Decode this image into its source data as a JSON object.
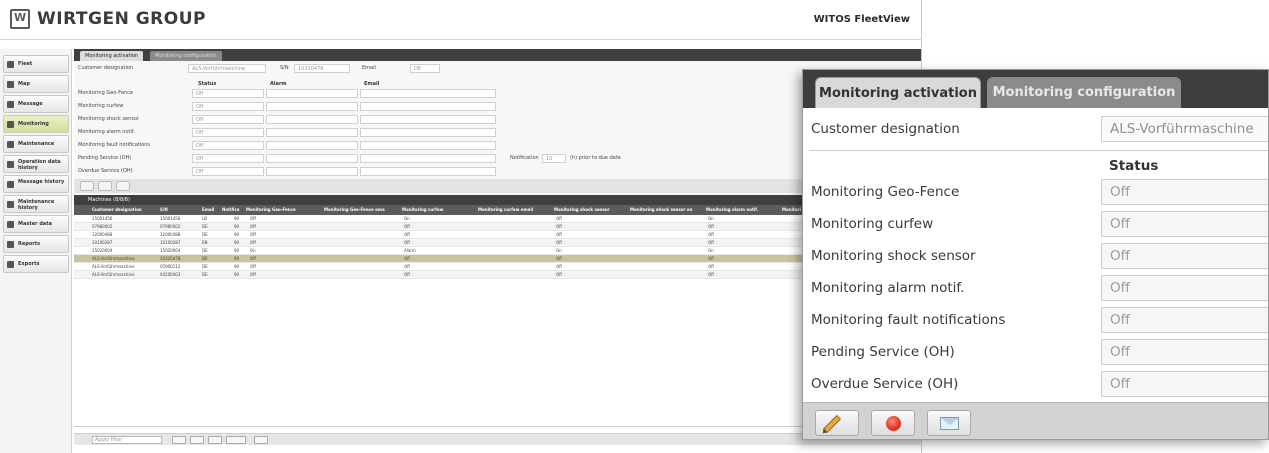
{
  "app": {
    "brand": "WIRTGEN GROUP",
    "product": "WITOS FleetView"
  },
  "sidebar": {
    "items": [
      {
        "label": "Fleet"
      },
      {
        "label": "Map"
      },
      {
        "label": "Message"
      },
      {
        "label": "Monitoring"
      },
      {
        "label": "Maintenance"
      },
      {
        "label": "Operation data history"
      },
      {
        "label": "Message history"
      },
      {
        "label": "Maintenance history"
      },
      {
        "label": "Master data"
      },
      {
        "label": "Reports"
      },
      {
        "label": "Exports"
      }
    ]
  },
  "background": {
    "tabs": [
      "Monitoring activation",
      "Monitoring configuration"
    ],
    "form": {
      "customer_label": "Customer designation",
      "customer_value": "ALS-Vorführmaschine",
      "sn_label": "S/N",
      "sn_value": "10320478",
      "email_label": "Email",
      "email_value": "DE",
      "head_status": "Status",
      "head_alarm": "Alarm",
      "head_email": "Email",
      "rows": [
        "Monitoring Geo-Fence",
        "Monitoring curfew",
        "Monitoring shock sensor",
        "Monitoring alarm notif.",
        "Monitoring fault notifications",
        "Pending Service (OH)",
        "Overdue Service (OH)"
      ],
      "off": "Off",
      "notification_label": "Notification",
      "notification_value": "10",
      "notification_suffix": "(h) prior to due date"
    },
    "machines_title": "Machines (8/8/8)",
    "columns": [
      "Customer designation",
      "S/N",
      "Email",
      "Notifica",
      "Monitoring Geo-Fence",
      "Monitoring Geo-Fence ema",
      "Monitoring curfew",
      "Monitoring curfew email",
      "Monitoring shock sensor",
      "Monitoring shock sensor en",
      "Monitoring alarm notif.",
      "Monitori"
    ],
    "rows": [
      {
        "name": "15001456",
        "sn": "15001456",
        "email": "LB",
        "notif": "90",
        "geo": "Off",
        "curfew": "On",
        "shock": "Off",
        "alarm": "On"
      },
      {
        "name": "07980002",
        "sn": "07980002",
        "email": "DE",
        "notif": "90",
        "geo": "Off",
        "curfew": "Off",
        "shock": "Off",
        "alarm": "Off"
      },
      {
        "name": "12000488",
        "sn": "12000488",
        "email": "DE",
        "notif": "90",
        "geo": "Off",
        "curfew": "Off",
        "shock": "Off",
        "alarm": "Off"
      },
      {
        "name": "10100287",
        "sn": "10100287",
        "email": "EN",
        "notif": "90",
        "geo": "Off",
        "curfew": "Off",
        "shock": "Off",
        "alarm": "Off"
      },
      {
        "name": "15020004",
        "sn": "15020004",
        "email": "DE",
        "notif": "90",
        "geo": "On",
        "curfew": "Alarm",
        "shock": "On",
        "alarm": "On"
      },
      {
        "name": "ALS-Vorführmaschine",
        "sn": "10320478",
        "email": "DE",
        "notif": "90",
        "geo": "Off",
        "curfew": "Off",
        "shock": "Off",
        "alarm": "Off"
      },
      {
        "name": "ALS-Vorführmaschine",
        "sn": "05900112",
        "email": "DE",
        "notif": "90",
        "geo": "Off",
        "curfew": "Off",
        "shock": "Off",
        "alarm": "Off"
      },
      {
        "name": "ALS-Vorführmaschine",
        "sn": "04200403",
        "email": "DE",
        "notif": "90",
        "geo": "Off",
        "curfew": "Off",
        "shock": "Off",
        "alarm": "Off"
      }
    ],
    "filter_placeholder": "Apply filter"
  },
  "panel": {
    "tab_activation": "Monitoring activation",
    "tab_configuration": "Monitoring configuration",
    "customer_label": "Customer designation",
    "customer_value": "ALS-Vorführmaschine",
    "status_header": "Status",
    "rows": [
      {
        "label": "Monitoring Geo-Fence",
        "value": "Off"
      },
      {
        "label": "Monitoring curfew",
        "value": "Off"
      },
      {
        "label": "Monitoring shock sensor",
        "value": "Off"
      },
      {
        "label": "Monitoring alarm notif.",
        "value": "Off"
      },
      {
        "label": "Monitoring fault notifications",
        "value": "Off"
      },
      {
        "label": "Pending Service (OH)",
        "value": "Off"
      },
      {
        "label": "Overdue Service (OH)",
        "value": "Off"
      }
    ],
    "toolbar": [
      "edit-icon",
      "record-icon",
      "email-icon"
    ]
  }
}
